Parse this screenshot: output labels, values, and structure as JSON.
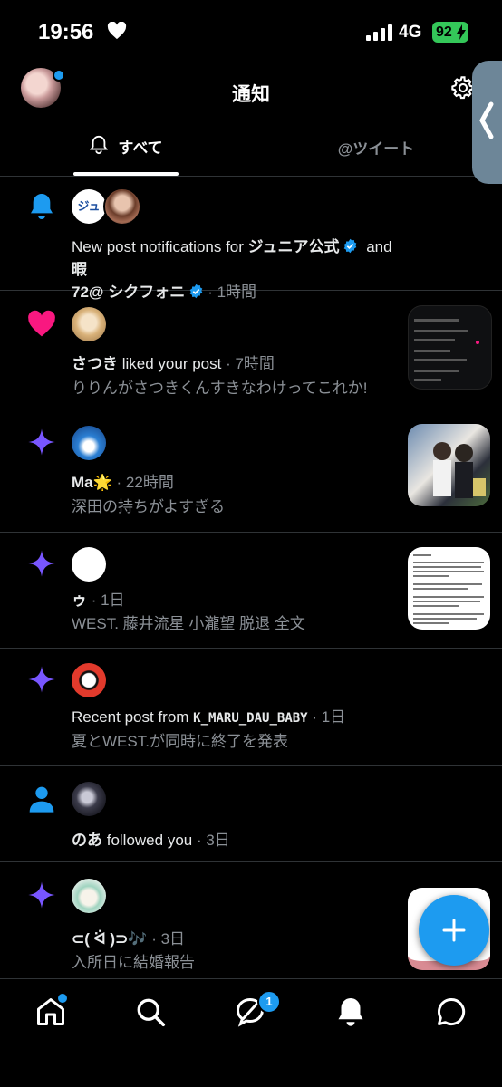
{
  "status_bar": {
    "time": "19:56",
    "network": "4G",
    "battery": "92"
  },
  "header": {
    "title": "通知"
  },
  "tabs": {
    "all": "すべて",
    "mentions": "@ツイート"
  },
  "colors": {
    "accent": "#1d9bf0",
    "like": "#f91880",
    "sparkle": "#7856ff",
    "verified": "#1d9bf0"
  },
  "notifications": [
    {
      "icon": "bell-icon",
      "text_a": "New post notifications for ",
      "name_a": "ジュニア公式",
      "text_b": " and ",
      "name_b": "暇",
      "name_c": "72@ シクフォニ",
      "time": "· 1時間",
      "avatar_text": "ジュニ"
    },
    {
      "icon": "heart-icon",
      "name": "さつき",
      "action": " liked your post",
      "time": " · 7時間",
      "body": "りりんがさつきくんすきなわけってこれか!"
    },
    {
      "icon": "sparkle-icon",
      "name": "Ma🌟",
      "time": " · 22時間",
      "body": "深田の持ちがよすぎる"
    },
    {
      "icon": "sparkle-icon",
      "name": "ゥ",
      "time": " · 1日",
      "body": "WEST. 藤井流星 小瀧望 脱退 全文"
    },
    {
      "icon": "sparkle-icon",
      "text": "Recent post from ",
      "name": "K_MARU_DAU_BABY",
      "time": " · 1日",
      "body": "夏とWEST.が同時に終了を発表"
    },
    {
      "icon": "person-icon",
      "name": "のあ",
      "action": " followed you",
      "time": " · 3日"
    },
    {
      "icon": "sparkle-icon",
      "name": "⊂( ᐛ )⊃🎶",
      "time": " · 3日",
      "body": "入所日に結婚報告"
    }
  ],
  "nav": {
    "messages_badge": "1"
  }
}
